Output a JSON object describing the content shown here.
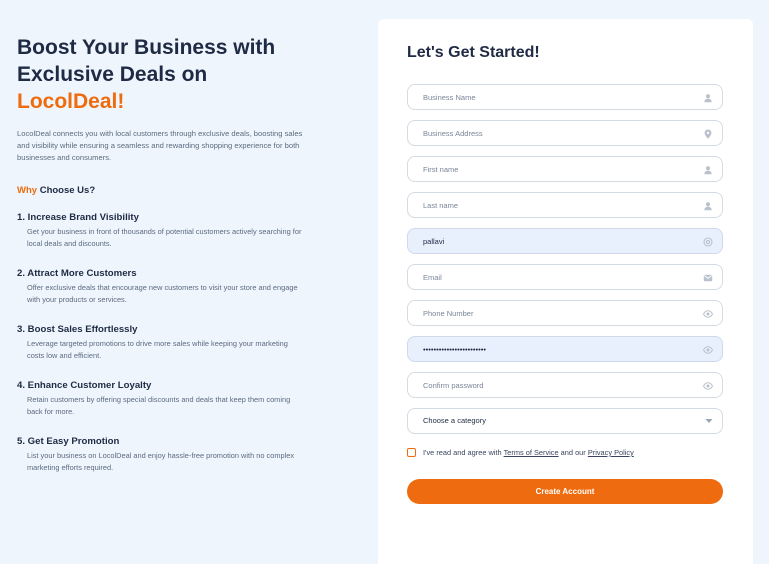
{
  "hero": {
    "title_line1": "Boost Your Business with",
    "title_line2": "Exclusive Deals on",
    "brand": "LocolDeal!",
    "intro": "LocolDeal connects you with local customers through exclusive deals, boosting sales and visibility while ensuring a seamless and rewarding shopping experience for both businesses and consumers."
  },
  "why": {
    "accent": "Why",
    "rest": " Choose Us?"
  },
  "benefits": [
    {
      "title": "1. Increase Brand Visibility",
      "desc": "Get your business in front of thousands of potential customers actively searching for local deals and discounts."
    },
    {
      "title": "2. Attract More Customers",
      "desc": "Offer exclusive deals that encourage new customers to visit your store and engage with your products or services."
    },
    {
      "title": "3. Boost Sales Effortlessly",
      "desc": "Leverage targeted promotions to drive more sales while keeping your marketing costs low and efficient."
    },
    {
      "title": "4. Enhance Customer Loyalty",
      "desc": "Retain customers by offering special discounts and deals that keep them coming back for more."
    },
    {
      "title": "5. Get Easy Promotion",
      "desc": "List your business on LocolDeal and enjoy hassle-free promotion with no complex marketing efforts required."
    }
  ],
  "form": {
    "title": "Let's Get Started!",
    "fields": {
      "business_name": {
        "placeholder": "Business Name",
        "value": "",
        "icon": "user-icon"
      },
      "business_address": {
        "placeholder": "Business Address",
        "value": "",
        "icon": "location-pin-icon"
      },
      "first_name": {
        "placeholder": "First name",
        "value": "",
        "icon": "user-icon"
      },
      "last_name": {
        "placeholder": "Last name",
        "value": "",
        "icon": "user-icon"
      },
      "username": {
        "placeholder": "",
        "value": "pallavi",
        "icon": "at-icon"
      },
      "email": {
        "placeholder": "Email",
        "value": "",
        "icon": "mail-icon"
      },
      "phone": {
        "placeholder": "Phone Number",
        "value": "",
        "icon": "eye-icon"
      },
      "password": {
        "placeholder": "",
        "value": "••••••••••••••••••••••••",
        "icon": "eye-icon"
      },
      "confirm_password": {
        "placeholder": "Confirm password",
        "value": "",
        "icon": "eye-icon"
      }
    },
    "category": {
      "selected": "Choose a category"
    },
    "agree": {
      "prefix": "I've read and agree with ",
      "terms": "Terms of Service",
      "middle": " and our ",
      "privacy": "Privacy Policy"
    },
    "submit_label": "Create Account"
  },
  "colors": {
    "accent": "#ee6c0f",
    "heading": "#1f2a44",
    "background": "#eef5fc",
    "autofill": "#e8f0fe"
  }
}
